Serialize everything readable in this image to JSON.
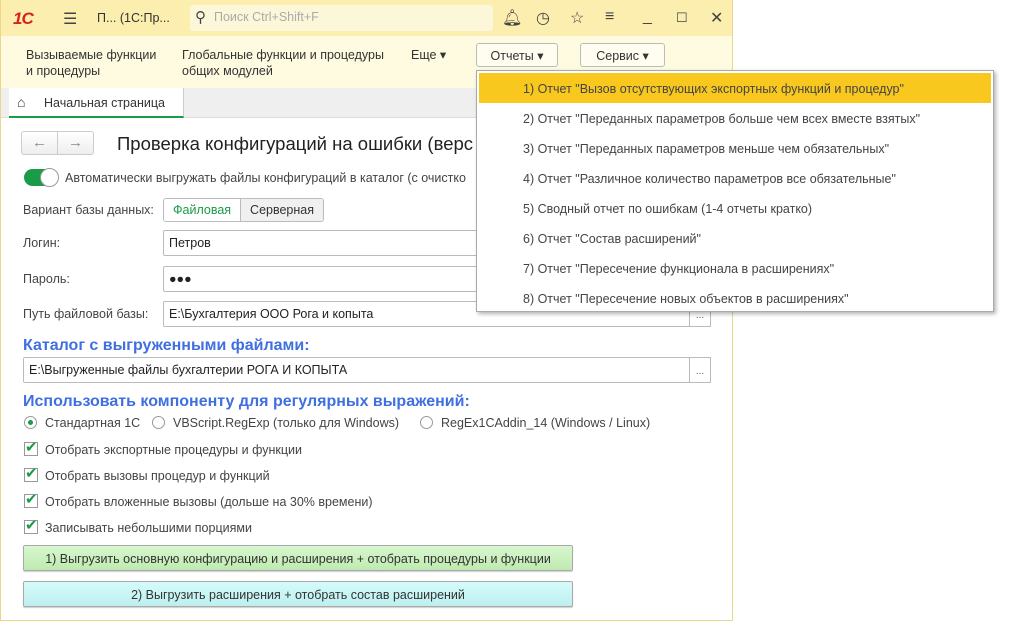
{
  "titlebar": {
    "logo": "1С",
    "title": "П...  (1С:Пр...",
    "search_placeholder": "Поиск Ctrl+Shift+F"
  },
  "toolbar": {
    "item1": "Вызываемые функции и процедуры",
    "item2": "Глобальные функции и процедуры общих модулей",
    "more": "Еще ▾",
    "reports": "Отчеты ▾",
    "service": "Сервис ▾"
  },
  "tabs": [
    {
      "label": "Начальная страница"
    }
  ],
  "form": {
    "title": "Проверка конфигураций на ошибки (верс",
    "auto_unload": "Автоматически выгружать файлы конфигураций в каталог (с очистко",
    "auto_unload_on": true,
    "db_variant_label": "Вариант базы данных:",
    "db_variant_options": [
      "Файловая",
      "Серверная"
    ],
    "db_variant_selected": "Файловая",
    "login_label": "Логин:",
    "login_value": "Петров",
    "password_label": "Пароль:",
    "password_value": "●●●",
    "path_label": "Путь файловой базы:",
    "path_value": "E:\\Бухгалтерия ООО Рога и копыта",
    "catalog_header": "Каталог с выгруженными файлами:",
    "catalog_value": "E:\\Выгруженные файлы бухгалтерии РОГА И КОПЫТА",
    "ellipsis": "...",
    "regex_header": "Использовать компоненту для регулярных выражений:",
    "regex_options": [
      "Стандартная 1С",
      "VBScript.RegExp (только для Windows)",
      "RegEx1CAddin_14 (Windows / Linux)"
    ],
    "regex_selected": "Стандартная 1С",
    "checkboxes": [
      {
        "label": "Отобрать экспортные процедуры и функции",
        "checked": true
      },
      {
        "label": "Отобрать вызовы процедур и функций",
        "checked": true
      },
      {
        "label": "Отобрать вложенные вызовы (дольше на 30% времени)",
        "checked": true
      },
      {
        "label": "Записывать небольшими порциями",
        "checked": true
      }
    ],
    "button1": "1) Выгрузить основную конфигурацию и расширения + отобрать процедуры и функции",
    "button2": "2) Выгрузить расширения + отобрать состав расширений"
  },
  "reports_menu": [
    "1) Отчет \"Вызов отсутствующих экспортных функций и процедур\"",
    "2) Отчет \"Переданных параметров больше чем всех вместе взятых\"",
    "3) Отчет \"Переданных параметров меньше чем обязательных\"",
    "4) Отчет \"Различное количество параметров все обязательные\"",
    "5) Сводный отчет по ошибкам (1-4 отчеты кратко)",
    "6) Отчет \"Состав расширений\"",
    "7) Отчет \"Пересечение функционала в расширениях\"",
    "8) Отчет \"Пересечение новых объектов в расширениях\""
  ],
  "colors": {
    "accent": "#1a9b47",
    "header": "#3f6fe0",
    "highlight": "#f9c81e",
    "titlebar": "#fbeeae"
  }
}
